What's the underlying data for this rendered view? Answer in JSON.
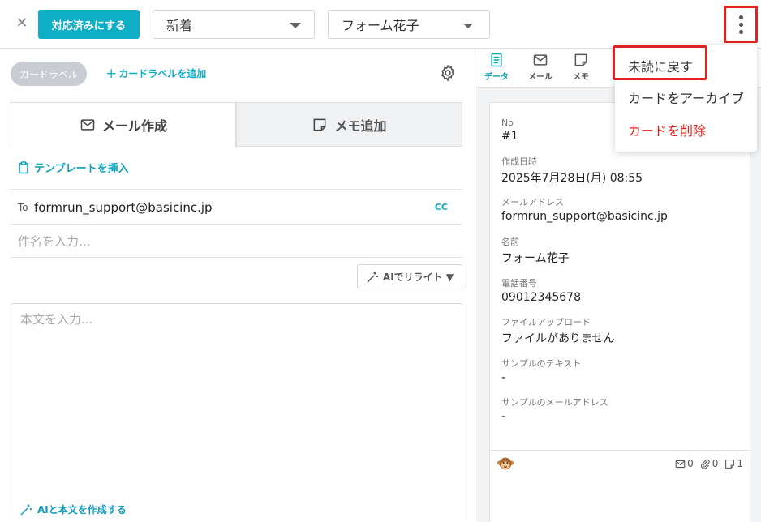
{
  "header": {
    "close_icon": "✕",
    "done_button": "対応済みにする",
    "status_select": "新着",
    "assignee_select": "フォーム花子"
  },
  "left": {
    "label_chip": "カードラベル",
    "add_label": "カードラベルを追加",
    "tabs": {
      "mail": "メール作成",
      "memo": "メモ追加"
    },
    "template_link": "テンプレートを挿入",
    "to_label": "To",
    "to_email": "formrun_support@basicinc.jp",
    "cc": "CC",
    "subject_placeholder": "件名を入力...",
    "ai_rewrite": "AIでリライト ▼",
    "body_placeholder": "本文を入力...",
    "ai_compose": "AIと本文を作成する"
  },
  "right": {
    "tabs": [
      {
        "label": "データ",
        "icon": "data-icon"
      },
      {
        "label": "メール",
        "icon": "mail-icon"
      },
      {
        "label": "メモ",
        "icon": "memo-icon"
      }
    ],
    "fields": [
      {
        "key": "No",
        "value": "#1"
      },
      {
        "key": "作成日時",
        "value": "2025年7月28日(月) 08:55"
      },
      {
        "key": "メールアドレス",
        "value": "formrun_support@basicinc.jp"
      },
      {
        "key": "名前",
        "value": "フォーム花子"
      },
      {
        "key": "電話番号",
        "value": "09012345678"
      },
      {
        "key": "ファイルアップロード",
        "value": "ファイルがありません"
      },
      {
        "key": "サンプルのテキスト",
        "value": "-"
      },
      {
        "key": "サンプルのメールアドレス",
        "value": "-"
      }
    ],
    "counts": {
      "mail": "0",
      "attachment": "0",
      "memo": "1"
    }
  },
  "menu": {
    "items": [
      "未読に戻す",
      "カードをアーカイブ",
      "カードを削除"
    ]
  },
  "colors": {
    "accent": "#0faec7",
    "danger": "#e0231e"
  }
}
